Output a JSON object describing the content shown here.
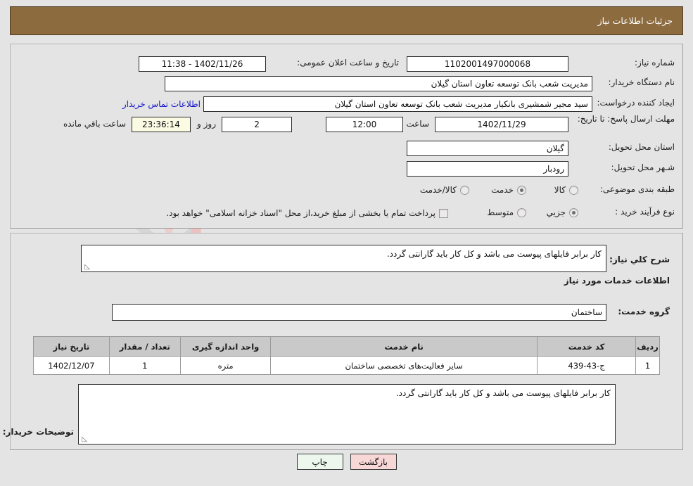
{
  "header": {
    "title": "جزئیات اطلاعات نیاز"
  },
  "top_panel": {
    "need_number": {
      "label": "شماره نیاز:",
      "value": "1102001497000068"
    },
    "announce_datetime": {
      "label": "تاریخ و ساعت اعلان عمومی:",
      "value": "1402/11/26 - 11:38"
    },
    "buyer_org": {
      "label": "نام دستگاه خریدار:",
      "value": "مدیریت شعب بانک توسعه تعاون استان گیلان"
    },
    "requester": {
      "label": "ایجاد کننده درخواست:",
      "value": "سید مجیر شمشیری بانکیار مدیریت شعب بانک توسعه تعاون استان گیلان"
    },
    "contact_link": {
      "label": "اطلاعات تماس خریدار"
    },
    "deadline": {
      "label": "مهلت ارسال پاسخ: تا تاریخ:",
      "date": "1402/11/29",
      "hour_label": "ساعت",
      "hour": "12:00",
      "days": "2",
      "days_label": "روز و",
      "countdown": "23:36:14",
      "countdown_label": "ساعت باقي مانده"
    },
    "province": {
      "label": "استان محل تحویل:",
      "value": "گیلان"
    },
    "city": {
      "label": "شـهر محل تحویل:",
      "value": "رودبار"
    },
    "category": {
      "label": "طبقه بندی موضوعی:",
      "options": [
        "کالا",
        "خدمت",
        "کالا/خدمت"
      ],
      "selected": "خدمت"
    },
    "purchase_type": {
      "label": "نوع فرآیند خرید :",
      "options": [
        "جزیي",
        "متوسط"
      ],
      "selected": "جزیي"
    },
    "treasury_note": {
      "checked": false,
      "text": "پرداخت تمام یا بخشی از مبلغ خرید،از محل \"اسناد خزانه اسلامی\" خواهد بود."
    }
  },
  "middle_panel": {
    "general_desc": {
      "label": "شرح کلي نیاز:",
      "value": "کار برابر فایلهای پیوست می باشد  و کل کار باید گارانتی گردد."
    },
    "section_title": "اطلاعات خدمات مورد نیاز",
    "service_group": {
      "label": "گروه خدمت:",
      "value": "ساختمان"
    },
    "table": {
      "columns": [
        "ردیف",
        "کد خدمت",
        "نام خدمت",
        "واحد اندازه گیری",
        "تعداد / مقدار",
        "تاریخ نیاز"
      ],
      "rows": [
        [
          "1",
          "ج-43-439",
          "سایر فعالیت‌های تخصصی ساختمان",
          "متره",
          "1",
          "1402/12/07"
        ]
      ]
    },
    "buyer_notes": {
      "label": "توضیحات خریدار:",
      "value": "کار برابر فایلهای پیوست می باشد  و کل کار باید گارانتی گردد."
    }
  },
  "footer": {
    "print_label": "چاپ",
    "back_label": "بازگشت"
  },
  "watermark": {
    "text": "AriaTender",
    "suffix": ".net"
  },
  "colors": {
    "header_bg": "#8c6b3f",
    "link": "#1414cd",
    "table_header_bg": "#c9c9c9",
    "print_btn": "#edf7ed",
    "back_btn": "#f8d7d7",
    "countdown_bg": "#fbfbe4"
  }
}
